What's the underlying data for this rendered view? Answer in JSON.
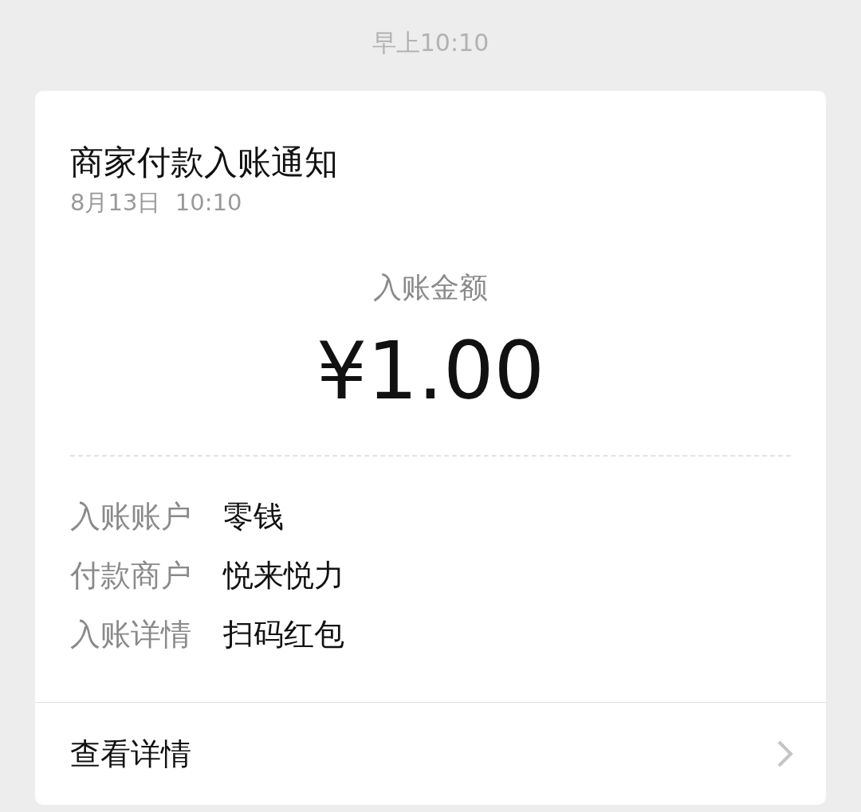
{
  "timestamp": "早上10:10",
  "card": {
    "title": "商家付款入账通知",
    "date": "8月13日  10:10",
    "amount_label": "入账金额",
    "amount": "¥1.00",
    "rows": [
      {
        "label": "入账账户",
        "value": "零钱"
      },
      {
        "label": "付款商户",
        "value": "悦来悦力"
      },
      {
        "label": "入账详情",
        "value": "扫码红包"
      }
    ],
    "footer_link": "查看详情"
  }
}
